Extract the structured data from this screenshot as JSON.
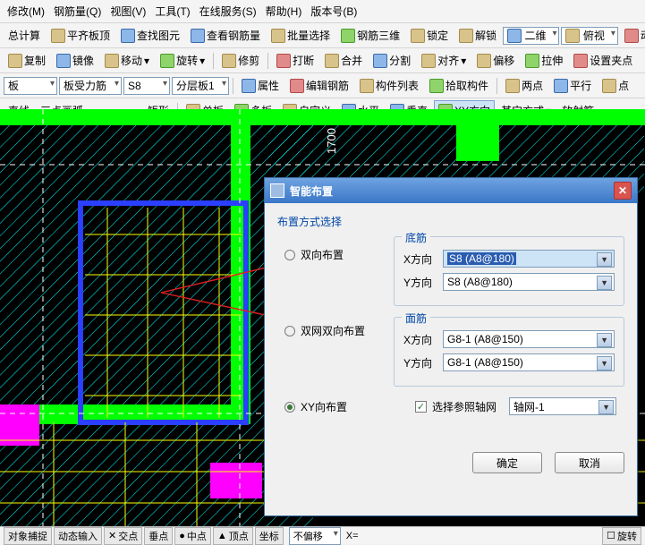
{
  "menu": {
    "modify": "修改(M)",
    "rebar": "钢筋量(Q)",
    "view": "视图(V)",
    "tool": "工具(T)",
    "online": "在线服务(S)",
    "help": "帮助(H)",
    "version": "版本号(B)"
  },
  "tb1": {
    "calc": "总计算",
    "flatten": "平齐板顶",
    "find": "查找图元",
    "viewRebar": "查看钢筋量",
    "batchSel": "批量选择",
    "rebar3d": "钢筋三维",
    "lock": "锁定",
    "unlock": "解锁",
    "dim2": "二维",
    "topview": "俯视",
    "dynview": "动态观"
  },
  "tb2": {
    "copy": "复制",
    "mirror": "镜像",
    "move": "移动",
    "rotate": "旋转",
    "trim": "修剪",
    "break": "打断",
    "merge": "合并",
    "split": "分割",
    "align": "对齐",
    "offset": "偏移",
    "stretch": "拉伸",
    "setClip": "设置夹点"
  },
  "tb3": {
    "boardCombo": "板",
    "forceRebar": "板受力筋",
    "s8": "S8",
    "layerBoard": "分层板1",
    "prop": "属性",
    "editRebar": "编辑钢筋",
    "memberList": "构件列表",
    "pick": "拾取构件",
    "twoPt": "两点",
    "parallel": "平行",
    "pt": "点"
  },
  "tb4": {
    "line": "直线",
    "arc3": "三点画弧",
    "rect": "矩形",
    "single": "单板",
    "multi": "多板",
    "custom": "自定义",
    "horiz": "水平",
    "vert": "垂直",
    "xy": "XY方向",
    "other": "其它方式",
    "radial": "放射筋"
  },
  "canvas": {
    "dim1700": "1700"
  },
  "dlg": {
    "title": "智能布置",
    "modeLabel": "布置方式选择",
    "r1": "双向布置",
    "r2": "双网双向布置",
    "r3": "XY向布置",
    "fs1": {
      "legend": "底筋",
      "xLabel": "X方向",
      "yLabel": "Y方向",
      "xVal": "S8 (A8@180)",
      "yVal": "S8 (A8@180)"
    },
    "fs2": {
      "legend": "面筋",
      "xLabel": "X方向",
      "yLabel": "Y方向",
      "xVal": "G8-1 (A8@150)",
      "yVal": "G8-1 (A8@150)"
    },
    "chkLabel": "选择参照轴网",
    "axisVal": "轴网-1",
    "ok": "确定",
    "cancel": "取消"
  },
  "status": {
    "snap": "对象捕捉",
    "dyn": "动态输入",
    "cross": "交点",
    "perp": "垂点",
    "mid": "中点",
    "top": "顶点",
    "center": "坐标",
    "noshift": "不偏移",
    "xeq": "X=",
    "rot": "旋转"
  }
}
